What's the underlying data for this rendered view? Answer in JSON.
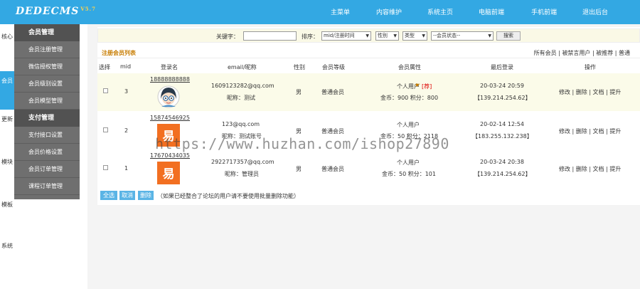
{
  "header": {
    "logo": "DEDECMS",
    "version": "V5.7",
    "nav": [
      "主菜单",
      "内容维护",
      "系统主页",
      "电脑前端",
      "手机前端",
      "退出后台"
    ]
  },
  "sidebar_tabs": [
    "核心",
    "会员",
    "更新",
    "模块",
    "模板",
    "系统"
  ],
  "sidebar": {
    "sections": [
      {
        "title": "会员管理",
        "items": [
          "会员注册管理",
          "微信授权管理",
          "会员级别设置",
          "会员模型管理"
        ]
      },
      {
        "title": "支付管理",
        "items": [
          "支付接口设置",
          "会员价格设置",
          "会员订单管理",
          "课程订单管理"
        ]
      }
    ]
  },
  "filter": {
    "keyword_label": "关键字：",
    "sort_label": "排序：",
    "sort_value": "mid/注册时间",
    "gender_value": "性别",
    "type_value": "类型",
    "status_value": "--会员状态--",
    "search_button": "搜索"
  },
  "list": {
    "title": "注册会员列表",
    "links": [
      "所有会员",
      "被禁言用户",
      "被推荐",
      "普通"
    ],
    "columns": [
      "选择",
      "mid",
      "登录名",
      "email/昵称",
      "性别",
      "会员等级",
      "会员属性",
      "最后登录",
      "操作"
    ],
    "rows": [
      {
        "mid": "3",
        "username": "18888888888",
        "email": "1609123282@qq.com",
        "nickname": "昵称：测试",
        "gender": "男",
        "level": "普通会员",
        "attr": "个人用户",
        "recommend": "[荐]",
        "money": "金币：900 积分：800",
        "date": "20-03-24 20:59",
        "ip": "【139.214.254.62】",
        "actions": "修改 | 删除 | 文档 | 提升",
        "avatar": "cartoon"
      },
      {
        "mid": "2",
        "username": "15874546925",
        "email": "123@qq.com",
        "nickname": "昵称：测试账号",
        "gender": "男",
        "level": "普通会员",
        "attr": "个人用户",
        "recommend": "",
        "money": "金币：50 积分：2118",
        "date": "20-02-14 12:54",
        "ip": "【183.255.132.238】",
        "actions": "修改 | 删除 | 文档 | 提升",
        "avatar": "yi"
      },
      {
        "mid": "1",
        "username": "17670434035",
        "email": "2922717357@qq.com",
        "nickname": "昵称：管理员",
        "gender": "男",
        "level": "普通会员",
        "attr": "个人用户",
        "recommend": "",
        "money": "金币：50 积分：101",
        "date": "20-03-24 20:38",
        "ip": "【139.214.254.62】",
        "actions": "修改 | 删除 | 文档 | 提升",
        "avatar": "yi"
      }
    ]
  },
  "bottom": {
    "select_all": "全选",
    "cancel": "取消",
    "delete": "删除",
    "note": "（如果已经整合了论坛的用户请不要使用批量删除功能）"
  },
  "watermark": "https://www.huzhan.com/ishop27890",
  "colors": {
    "accent": "#33a8e3",
    "sidebar": "#6f6f6f",
    "avatar_orange": "#f26f21"
  }
}
